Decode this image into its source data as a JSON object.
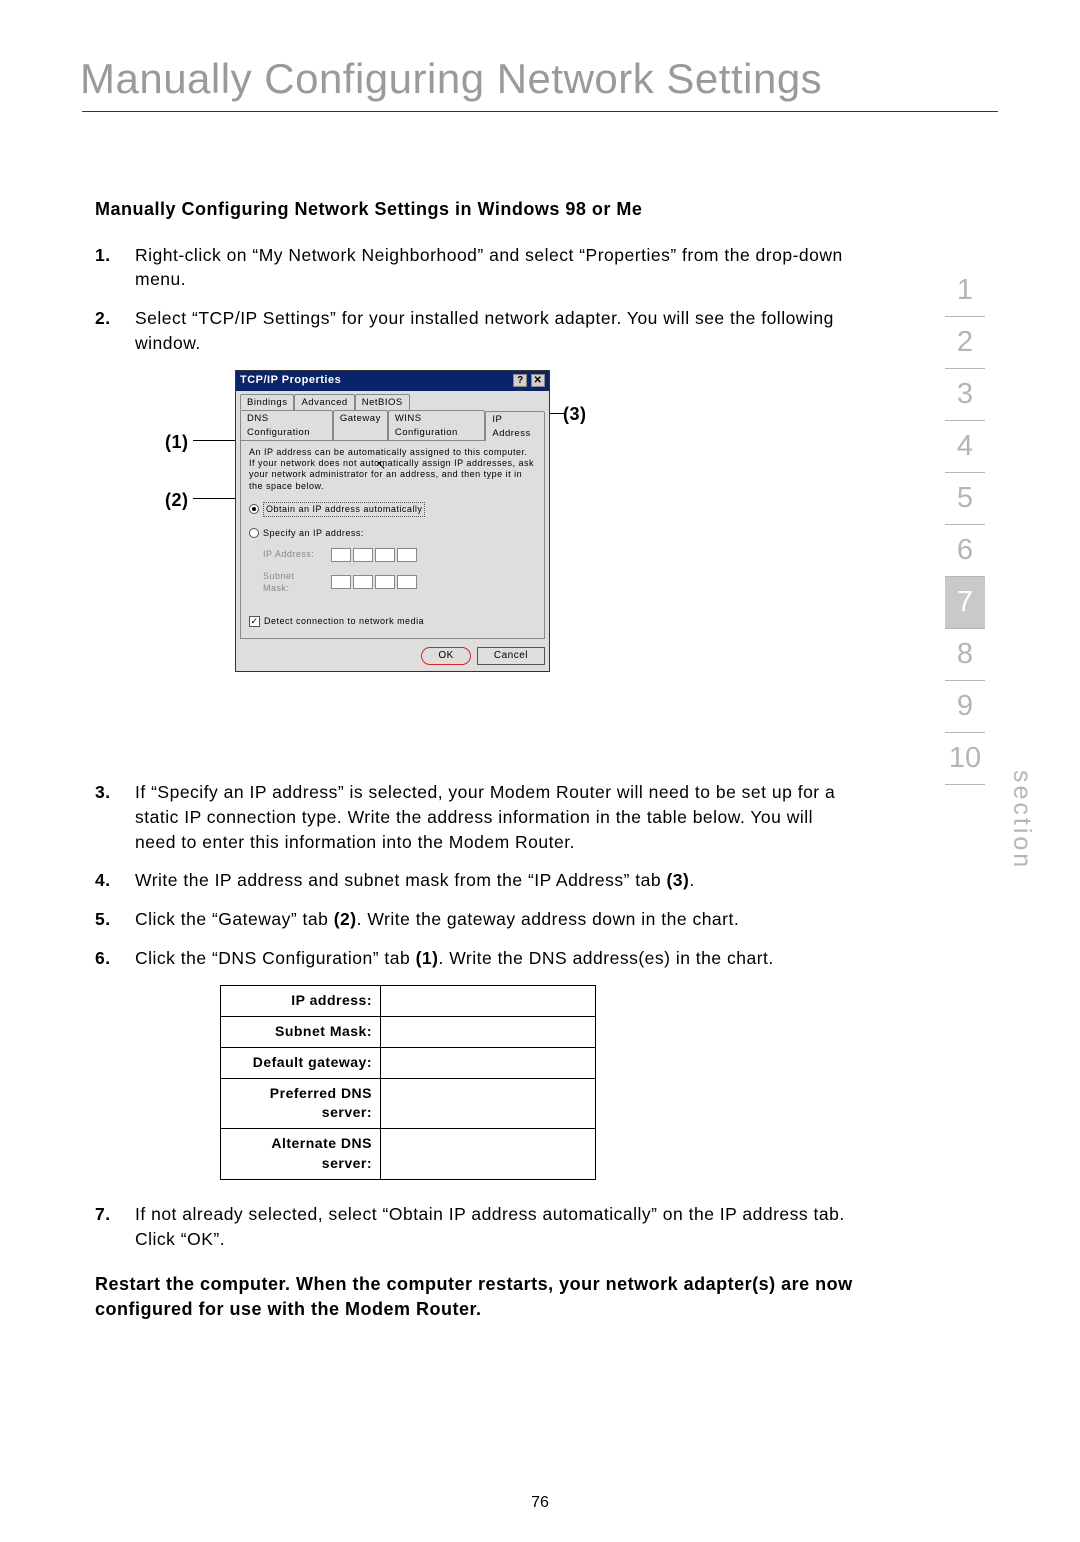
{
  "page_title": "Manually Configuring Network Settings",
  "sub_heading": "Manually Configuring Network Settings in Windows 98 or Me",
  "steps": {
    "1": "Right-click on “My Network Neighborhood” and select “Properties” from the drop-down menu.",
    "2": "Select “TCP/IP Settings” for your installed network adapter. You will see the following window.",
    "3": "If “Specify an IP address” is selected, your Modem Router will need to be set up for a static IP connection type. Write the address information in the table below. You will need to enter this information into the Modem Router.",
    "4_pre": "Write the IP address and subnet mask from the “IP Address” tab ",
    "4_bold": "(3)",
    "4_post": ".",
    "5_pre": "Click the “Gateway” tab ",
    "5_bold": "(2)",
    "5_post": ". Write the gateway address down in the chart.",
    "6_pre": "Click the “DNS Configuration” tab ",
    "6_bold": "(1)",
    "6_post": ". Write the DNS address(es) in the chart.",
    "7": "If not already selected, select “Obtain IP address automatically” on the IP address tab. Click “OK”."
  },
  "restart_note": "Restart the computer. When the computer restarts, your network adapter(s) are now configured for use with the Modem Router.",
  "page_number": "76",
  "section_nav": [
    "1",
    "2",
    "3",
    "4",
    "5",
    "6",
    "7",
    "8",
    "9",
    "10"
  ],
  "section_active_index": 6,
  "section_label": "section",
  "callouts": {
    "one": "(1)",
    "two": "(2)",
    "three": "(3)"
  },
  "dialog": {
    "title": "TCP/IP Properties",
    "help": "?",
    "close": "✕",
    "tabs_row1": [
      "Bindings",
      "Advanced",
      "NetBIOS"
    ],
    "tabs_row2": [
      "DNS Configuration",
      "Gateway",
      "WINS Configuration",
      "IP Address"
    ],
    "desc": "An IP address can be automatically assigned to this computer. If your network does not automatically assign IP addresses, ask your network administrator for an address, and then type it in the space below.",
    "radio_auto": "Obtain an IP address automatically",
    "radio_specify": "Specify an IP address:",
    "ip_label": "IP Address:",
    "mask_label": "Subnet Mask:",
    "detect": "Detect connection to network media",
    "ok": "OK",
    "cancel": "Cancel"
  },
  "ip_table": {
    "rows": [
      "IP address:",
      "Subnet Mask:",
      "Default gateway:",
      "Preferred DNS server:",
      "Alternate DNS server:"
    ]
  }
}
